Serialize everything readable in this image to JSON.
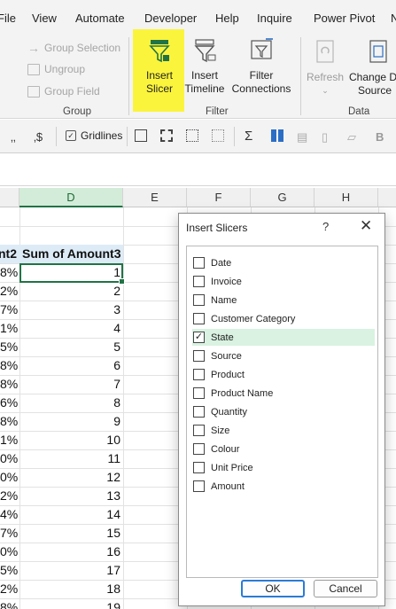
{
  "menubar": {
    "items": [
      "File",
      "View",
      "Automate",
      "Developer",
      "Help",
      "Inquire",
      "Power Pivot",
      "N"
    ]
  },
  "ribbon": {
    "group_group": {
      "label": "Group",
      "group_selection": "Group Selection",
      "ungroup": "Ungroup",
      "group_field": "Group Field"
    },
    "filter_group": {
      "label": "Filter",
      "insert_slicer": [
        "Insert",
        "Slicer"
      ],
      "insert_timeline": [
        "Insert",
        "Timeline"
      ],
      "filter_connections": [
        "Filter",
        "Connections"
      ]
    },
    "data_group": {
      "label": "Data",
      "refresh": "Refresh",
      "change_source": [
        "Change D",
        "Source"
      ]
    }
  },
  "strip": {
    "gridlines_label": "Gridlines",
    "gridlines_checked": "✓",
    "bold_label": "B"
  },
  "sheet": {
    "columns": [
      "D",
      "E",
      "F",
      "G",
      "H"
    ],
    "header_left": "nt2",
    "header_d": "Sum of Amount3",
    "left_values": [
      "8%",
      "2%",
      "7%",
      "1%",
      "5%",
      "8%",
      "8%",
      "6%",
      "8%",
      "1%",
      "0%",
      "0%",
      "2%",
      "4%",
      "7%",
      "0%",
      "5%",
      "2%",
      "8%"
    ],
    "d_values": [
      "1",
      "2",
      "3",
      "4",
      "5",
      "6",
      "7",
      "8",
      "9",
      "10",
      "11",
      "12",
      "13",
      "14",
      "15",
      "16",
      "17",
      "18",
      "19"
    ]
  },
  "dialog": {
    "title": "Insert Slicers",
    "help": "?",
    "close": "✕",
    "fields": [
      {
        "label": "Date",
        "checked": false
      },
      {
        "label": "Invoice",
        "checked": false
      },
      {
        "label": "Name",
        "checked": false
      },
      {
        "label": "Customer Category",
        "checked": false
      },
      {
        "label": "State",
        "checked": true
      },
      {
        "label": "Source",
        "checked": false
      },
      {
        "label": "Product",
        "checked": false
      },
      {
        "label": "Product Name",
        "checked": false
      },
      {
        "label": "Quantity",
        "checked": false
      },
      {
        "label": "Size",
        "checked": false
      },
      {
        "label": "Colour",
        "checked": false
      },
      {
        "label": "Unit Price",
        "checked": false
      },
      {
        "label": "Amount",
        "checked": false
      }
    ],
    "ok_label": "OK",
    "cancel_label": "Cancel"
  },
  "colors": {
    "highlight": "#fbf43c",
    "excel_green": "#217346",
    "header_fill": "#ddebf7",
    "checked_row": "#d9f2e1"
  }
}
